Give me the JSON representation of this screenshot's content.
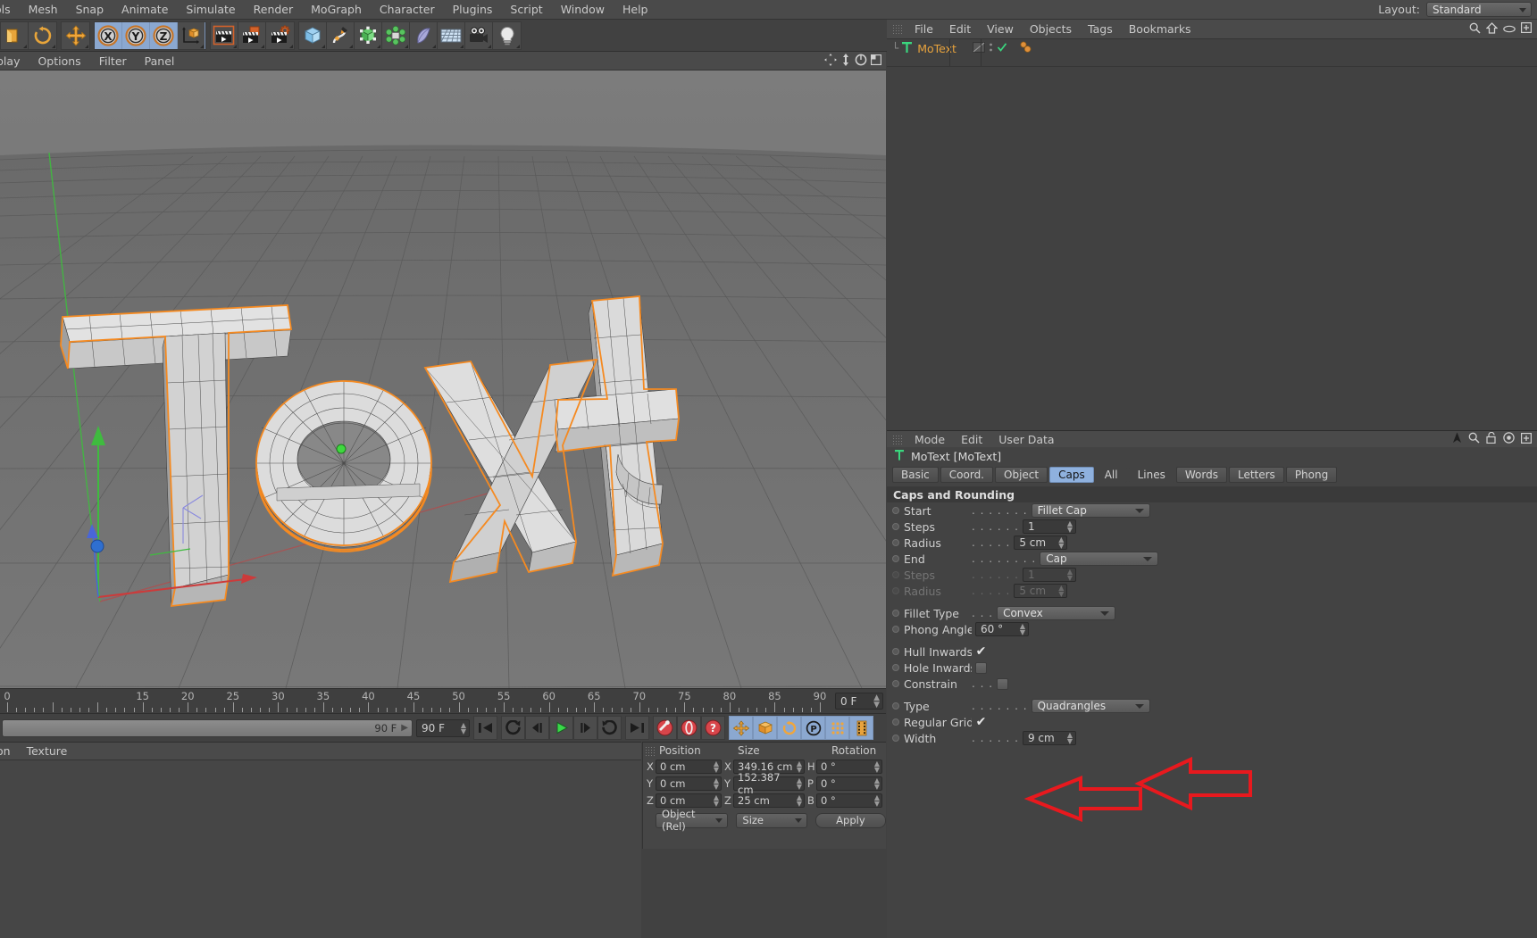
{
  "menubar": {
    "items": [
      "ols",
      "Mesh",
      "Snap",
      "Animate",
      "Simulate",
      "Render",
      "MoGraph",
      "Character",
      "Plugins",
      "Script",
      "Window",
      "Help"
    ],
    "layout_label": "Layout:",
    "layout_value": "Standard"
  },
  "toolbar": {
    "groups": [
      {
        "highlight": false,
        "buttons": [
          {
            "name": "undo-icon",
            "glyph": "undo"
          },
          {
            "name": "redo-icon",
            "glyph": "redo"
          }
        ]
      },
      {
        "highlight": false,
        "buttons": [
          {
            "name": "move-tool-icon",
            "glyph": "move"
          }
        ]
      },
      {
        "highlight": true,
        "buttons": [
          {
            "name": "x-axis-lock-icon",
            "glyph": "X"
          },
          {
            "name": "y-axis-lock-icon",
            "glyph": "Y"
          },
          {
            "name": "z-axis-lock-icon",
            "glyph": "Z"
          },
          {
            "name": "world-object-axis-icon",
            "glyph": "axis"
          }
        ]
      },
      {
        "highlight": false,
        "buttons": [
          {
            "name": "render-view-icon",
            "glyph": "clap1"
          },
          {
            "name": "render-region-icon",
            "glyph": "clap2"
          },
          {
            "name": "render-settings-icon",
            "glyph": "clap3"
          }
        ]
      },
      {
        "highlight": false,
        "buttons": [
          {
            "name": "primitive-cube-icon",
            "glyph": "cube"
          },
          {
            "name": "spline-pen-icon",
            "glyph": "spline"
          },
          {
            "name": "generator-icon",
            "glyph": "generator"
          },
          {
            "name": "deformer-icon",
            "glyph": "deformer"
          },
          {
            "name": "bend-icon",
            "glyph": "bend"
          },
          {
            "name": "environment-floor-icon",
            "glyph": "floor"
          },
          {
            "name": "camera-icon",
            "glyph": "camera"
          },
          {
            "name": "light-icon",
            "glyph": "light"
          }
        ]
      }
    ]
  },
  "viewport": {
    "menu": [
      "play",
      "Options",
      "Filter",
      "Panel"
    ],
    "nav_icons": [
      "move-view-icon",
      "scale-view-icon",
      "rotate-view-icon",
      "maximize-view-icon"
    ],
    "object_text": "Text"
  },
  "timeline": {
    "tick_labels": [
      "0",
      "15",
      "20",
      "25",
      "30",
      "35",
      "40",
      "45",
      "50",
      "55",
      "60",
      "65",
      "70",
      "75",
      "80",
      "85",
      "90"
    ],
    "tick_values": [
      0,
      15,
      20,
      25,
      30,
      35,
      40,
      45,
      50,
      55,
      60,
      65,
      70,
      75,
      80,
      85,
      90
    ],
    "current_frame": "0 F"
  },
  "transport": {
    "range_end_label": "90 F",
    "end_field": "90 F",
    "buttons": [
      {
        "name": "goto-start-button",
        "glyph": "gostart"
      },
      {
        "name": "previous-key-button",
        "glyph": "prevkey"
      },
      {
        "name": "step-back-button",
        "glyph": "stepback"
      },
      {
        "name": "play-button",
        "glyph": "play"
      },
      {
        "name": "step-forward-button",
        "glyph": "stepfwd"
      },
      {
        "name": "next-key-button",
        "glyph": "nextkey"
      },
      {
        "name": "goto-end-button",
        "glyph": "goend"
      },
      {
        "name": "record-key-button",
        "glyph": "key"
      },
      {
        "name": "autokey-button",
        "glyph": "autokey"
      },
      {
        "name": "keyframe-help-button",
        "glyph": "question"
      },
      {
        "name": "position-key-button",
        "glyph": "poskey"
      },
      {
        "name": "scale-key-button",
        "glyph": "scalekey"
      },
      {
        "name": "rotation-key-button",
        "glyph": "rotkey"
      },
      {
        "name": "param-key-button",
        "glyph": "pkey"
      },
      {
        "name": "pointlevel-key-button",
        "glyph": "dots"
      },
      {
        "name": "timeline-button",
        "glyph": "film"
      }
    ]
  },
  "material_manager": {
    "menu": [
      "on",
      "Texture"
    ]
  },
  "coordinates": {
    "columns": [
      "Position",
      "Size",
      "Rotation"
    ],
    "position": {
      "labels": [
        "X",
        "Y",
        "Z"
      ],
      "values": [
        "0 cm",
        "0 cm",
        "0 cm"
      ]
    },
    "size": {
      "labels": [
        "X",
        "Y",
        "Z"
      ],
      "values": [
        "349.16 cm",
        "152.387 cm",
        "25 cm"
      ]
    },
    "rotation": {
      "labels": [
        "H",
        "P",
        "B"
      ],
      "values": [
        "0 °",
        "0 °",
        "0 °"
      ]
    },
    "mode_select": "Object (Rel)",
    "size_select": "Size",
    "apply_button": "Apply"
  },
  "object_manager": {
    "menu": [
      "File",
      "Edit",
      "View",
      "Objects",
      "Tags",
      "Bookmarks"
    ],
    "header_icons": [
      "search-icon",
      "home-icon",
      "eye-icon",
      "plus-icon"
    ],
    "objects": [
      {
        "name": "MoText",
        "icon": "text-object-icon",
        "visible_check": true,
        "tags": [
          "mograph-tag",
          "mograph-tag-2"
        ]
      }
    ]
  },
  "attribute_manager": {
    "menu": [
      "Mode",
      "Edit",
      "User Data"
    ],
    "header_icons": [
      "cursor-icon",
      "search-icon",
      "lock-icon",
      "target-icon",
      "plus-icon"
    ],
    "object_title": "MoText [MoText]",
    "tabs": [
      {
        "label": "Basic",
        "active": false
      },
      {
        "label": "Coord.",
        "active": false
      },
      {
        "label": "Object",
        "active": false
      },
      {
        "label": "Caps",
        "active": true
      },
      {
        "label": "All",
        "active": false
      },
      {
        "label": "Lines",
        "active": false
      },
      {
        "label": "Words",
        "active": false
      },
      {
        "label": "Letters",
        "active": false
      },
      {
        "label": "Phong",
        "active": false
      }
    ],
    "group_title": "Caps and Rounding",
    "rows": [
      {
        "type": "combo",
        "label": "Start",
        "dots": ". . . . . . .",
        "value": "Fillet Cap",
        "disabled": false,
        "name": "start-cap"
      },
      {
        "type": "num",
        "label": "Steps",
        "dots": ". . . . . .",
        "value": "1",
        "disabled": false,
        "name": "start-steps"
      },
      {
        "type": "num",
        "label": "Radius",
        "dots": ". . . . .",
        "value": "5 cm",
        "disabled": false,
        "name": "start-radius"
      },
      {
        "type": "combo",
        "label": "End",
        "dots": ". . . . . . . .",
        "value": "Cap",
        "disabled": false,
        "name": "end-cap"
      },
      {
        "type": "num",
        "label": "Steps",
        "dots": ". . . . . .",
        "value": "1",
        "disabled": true,
        "name": "end-steps"
      },
      {
        "type": "num",
        "label": "Radius",
        "dots": ". . . . .",
        "value": "5 cm",
        "disabled": true,
        "name": "end-radius"
      },
      {
        "type": "gap"
      },
      {
        "type": "combo",
        "label": "Fillet Type",
        "dots": ". . .",
        "value": "Convex",
        "disabled": false,
        "name": "fillet-type"
      },
      {
        "type": "num",
        "label": "Phong Angle",
        "dots": "",
        "value": "60 °",
        "disabled": false,
        "name": "phong-angle"
      },
      {
        "type": "gap"
      },
      {
        "type": "check",
        "label": "Hull Inwards",
        "dots": "",
        "value": true,
        "disabled": false,
        "name": "hull-inwards"
      },
      {
        "type": "check",
        "label": "Hole Inwards",
        "dots": "",
        "value": false,
        "disabled": false,
        "name": "hole-inwards"
      },
      {
        "type": "check",
        "label": "Constrain",
        "dots": ". . .",
        "value": false,
        "disabled": false,
        "name": "constrain"
      },
      {
        "type": "gap"
      },
      {
        "type": "combo",
        "label": "Type",
        "dots": ". . . . . . .",
        "value": "Quadrangles",
        "disabled": false,
        "name": "type"
      },
      {
        "type": "check",
        "label": "Regular Grid",
        "dots": "",
        "value": true,
        "disabled": false,
        "name": "regular-grid"
      },
      {
        "type": "num",
        "label": "Width",
        "dots": ". . . . . .",
        "value": "9 cm",
        "disabled": false,
        "name": "width"
      }
    ]
  },
  "annotations": {
    "arrow_color": "#e8191e",
    "arrows": [
      {
        "name": "red-arrow-upper",
        "points_to": "regular-grid"
      },
      {
        "name": "red-arrow-lower",
        "points_to": "width"
      }
    ]
  },
  "colors": {
    "accent_blue": "#8fb1de",
    "panel_bg": "#434343",
    "toolbar_bg": "#414141",
    "viewport_bg": "#6e6e6e",
    "selection_orange": "#f0882a",
    "object_text_color": "#e8a33d"
  }
}
